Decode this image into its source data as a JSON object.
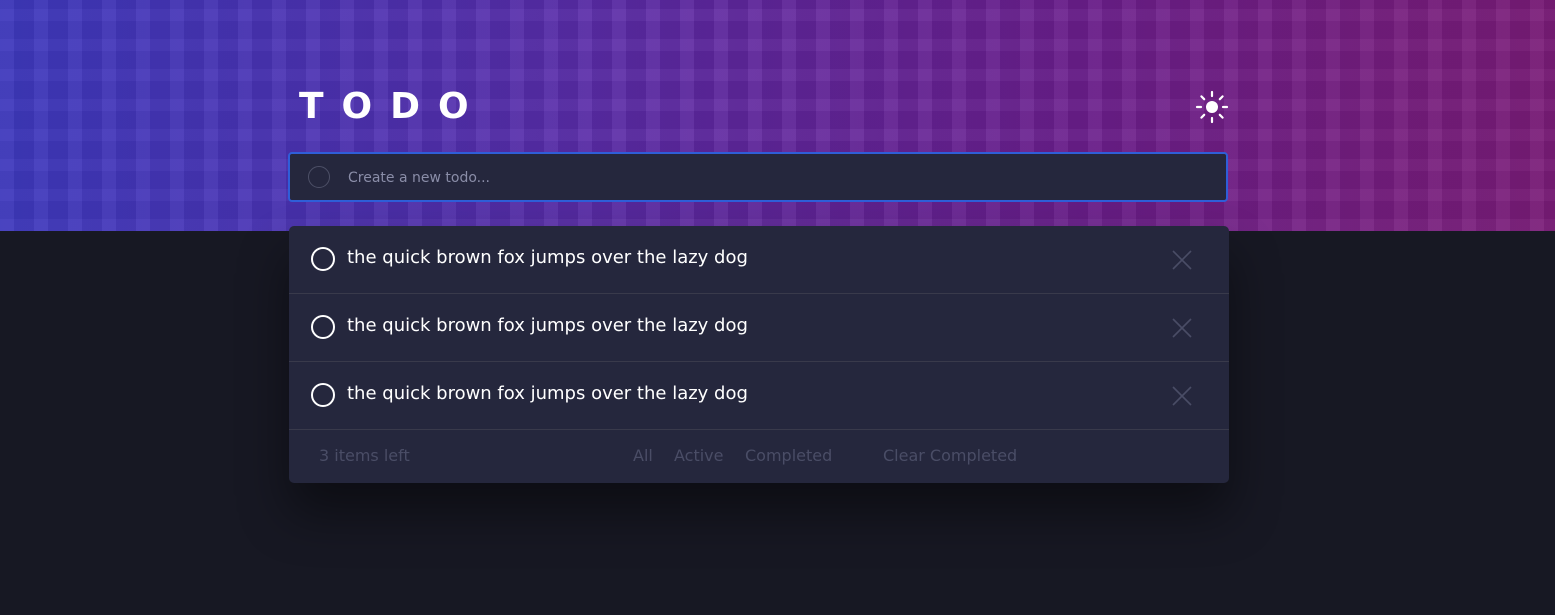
{
  "app": {
    "title": "TODO",
    "theme_icon": "sun-icon"
  },
  "new_todo": {
    "placeholder": "Create a new todo...",
    "value": ""
  },
  "todos": [
    {
      "text": "the quick brown fox jumps over the lazy dog",
      "completed": false
    },
    {
      "text": "the quick brown fox jumps over the lazy dog",
      "completed": false
    },
    {
      "text": "the quick brown fox jumps over the lazy dog",
      "completed": false
    }
  ],
  "footer": {
    "items_left": "3 items left",
    "filters": [
      "All",
      "Active",
      "Completed"
    ],
    "clear_label": "Clear Completed"
  },
  "colors": {
    "background": "#171823",
    "panel": "#25273d",
    "input_border": "#2f5ed8",
    "muted_text": "#4a4d66",
    "header_gradient_start": "#3e2fb0",
    "header_gradient_end": "#7a1d7b"
  }
}
